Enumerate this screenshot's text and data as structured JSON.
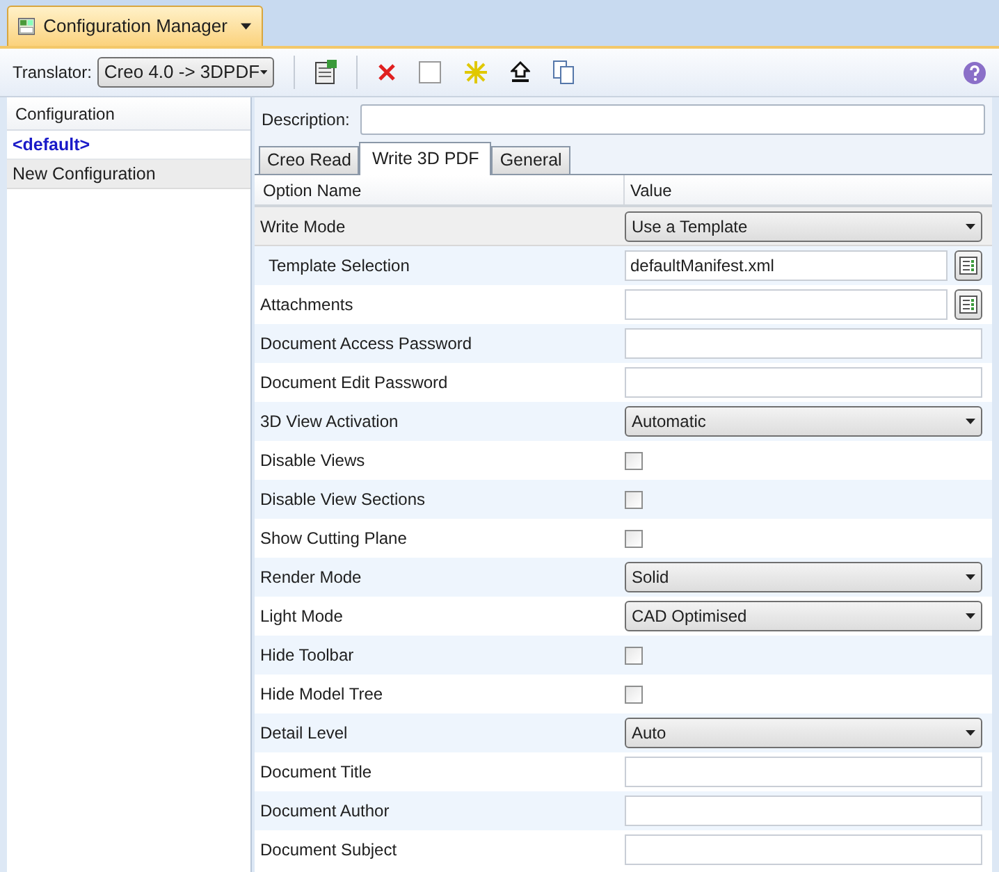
{
  "tab": {
    "title": "Configuration Manager"
  },
  "toolbar": {
    "translator_label": "Translator:",
    "translator_value": "Creo 4.0 -> 3DPDF"
  },
  "configurations": {
    "header": "Configuration",
    "items": [
      {
        "label": "<default>",
        "selected": true
      },
      {
        "label": "New Configuration",
        "selected": false
      }
    ]
  },
  "description": {
    "label": "Description:"
  },
  "tabs": [
    {
      "label": "Creo Read",
      "selected": false
    },
    {
      "label": "Write 3D PDF",
      "selected": true
    },
    {
      "label": "General",
      "selected": false
    }
  ],
  "grid": {
    "columns": [
      "Option Name",
      "Value"
    ],
    "rows": [
      {
        "name": "Write Mode",
        "kind": "dropdown",
        "value": "Use a Template",
        "selected": true,
        "children": [
          {
            "name": "Template Selection",
            "kind": "file",
            "value": "defaultManifest.xml",
            "selected": false
          }
        ]
      },
      {
        "name": "Attachments",
        "kind": "file",
        "selected": false
      },
      {
        "name": "Document Access Password",
        "kind": "text",
        "selected": false
      },
      {
        "name": "Document Edit Password",
        "kind": "text",
        "selected": false
      },
      {
        "name": "3D View Activation",
        "kind": "dropdown",
        "value": "Automatic",
        "selected": false
      },
      {
        "name": "Disable Views",
        "kind": "checkbox",
        "checked": false,
        "selected": false
      },
      {
        "name": "Disable View Sections",
        "kind": "checkbox",
        "checked": false,
        "selected": false
      },
      {
        "name": "Show Cutting Plane",
        "kind": "checkbox",
        "checked": false,
        "selected": false
      },
      {
        "name": "Render Mode",
        "kind": "dropdown",
        "value": "Solid",
        "selected": false
      },
      {
        "name": "Light Mode",
        "kind": "dropdown",
        "value": "CAD Optimised",
        "selected": false
      },
      {
        "name": "Hide Toolbar",
        "kind": "checkbox",
        "checked": false,
        "selected": false
      },
      {
        "name": "Hide Model Tree",
        "kind": "checkbox",
        "checked": false,
        "selected": false
      },
      {
        "name": "Detail Level",
        "kind": "dropdown",
        "value": "Auto",
        "selected": false
      },
      {
        "name": "Document Title",
        "kind": "text",
        "selected": false
      },
      {
        "name": "Document Author",
        "kind": "text",
        "selected": false
      },
      {
        "name": "Document Subject",
        "kind": "text",
        "selected": false
      }
    ]
  }
}
